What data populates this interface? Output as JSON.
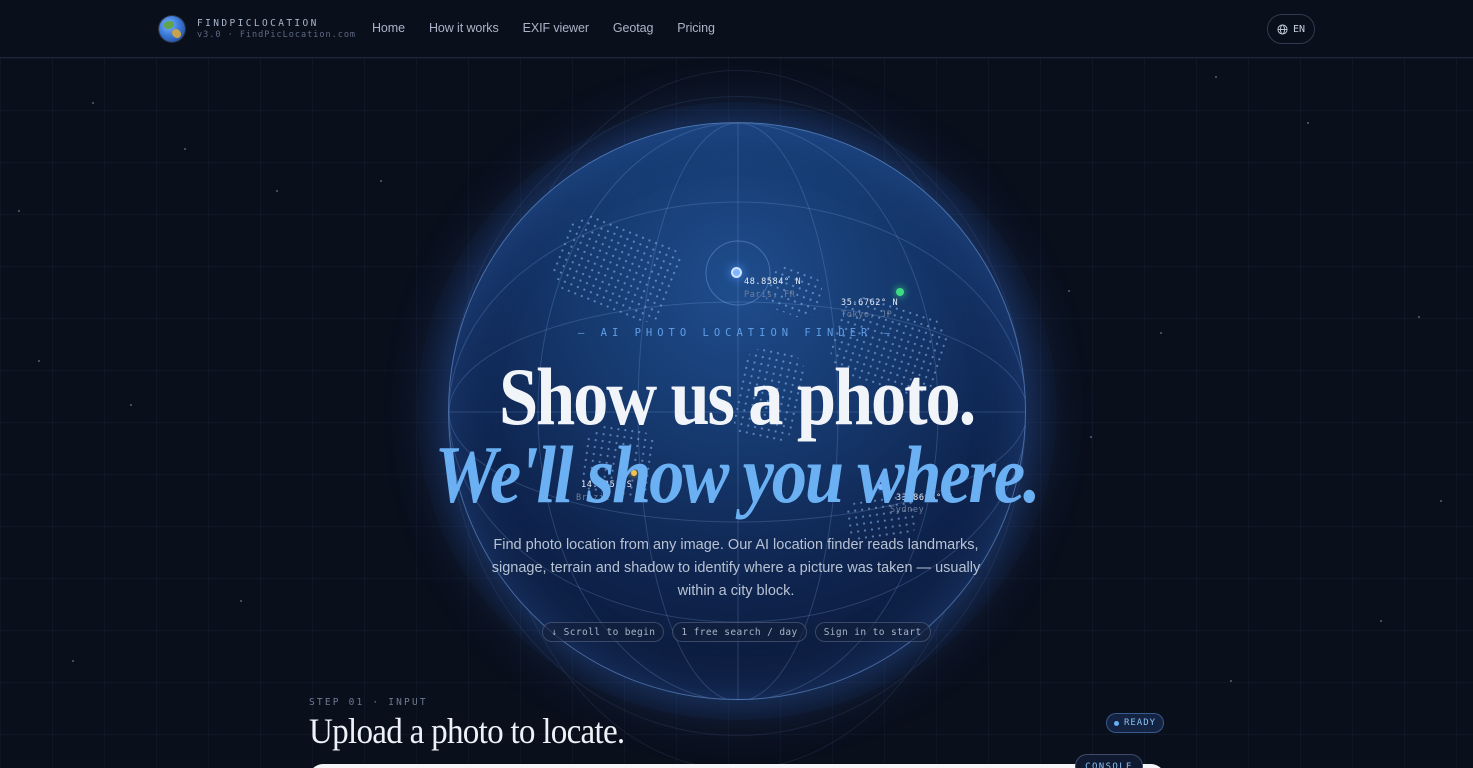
{
  "header": {
    "brand_name": "FINDPICLOCATION",
    "brand_sub": "v3.0 · FindPicLocation.com",
    "logo_icon": "globe-icon",
    "nav": [
      {
        "label": "Home"
      },
      {
        "label": "How it works"
      },
      {
        "label": "EXIF viewer"
      },
      {
        "label": "Geotag"
      },
      {
        "label": "Pricing"
      }
    ],
    "language": "EN"
  },
  "hero": {
    "eyebrow": "— AI PHOTO LOCATION FINDER —",
    "headline": "Show us a photo.",
    "headline_accent": "We'll show you where.",
    "lede": "Find photo location from any image. Our AI location finder reads landmarks, signage, terrain and shadow to identify where a picture was taken — usually within a city block.",
    "chips": [
      {
        "label": "↓ Scroll to begin"
      },
      {
        "label": "1 free search / day"
      },
      {
        "label": "Sign in to start"
      }
    ],
    "pins": [
      {
        "coord": "48.8584° N",
        "city": "Paris, FR",
        "color": "#7fb6ff"
      },
      {
        "coord": "35.6762° N",
        "city": "Tokyo, JP",
        "color": "#3ddc84"
      },
      {
        "coord": "14.235° S",
        "city": "Brazil",
        "color": "#f2c14e"
      },
      {
        "coord": "33.8688° S",
        "city": "Sydney",
        "color": "#7fb6ff"
      }
    ]
  },
  "step": {
    "label": "STEP 01 · INPUT",
    "title": "Upload a photo to locate.",
    "status": "READY",
    "console_tab": "CONSOLE"
  },
  "colors": {
    "background": "#0a0f1c",
    "accent": "#6ab0f2",
    "globe": "#163a70"
  }
}
